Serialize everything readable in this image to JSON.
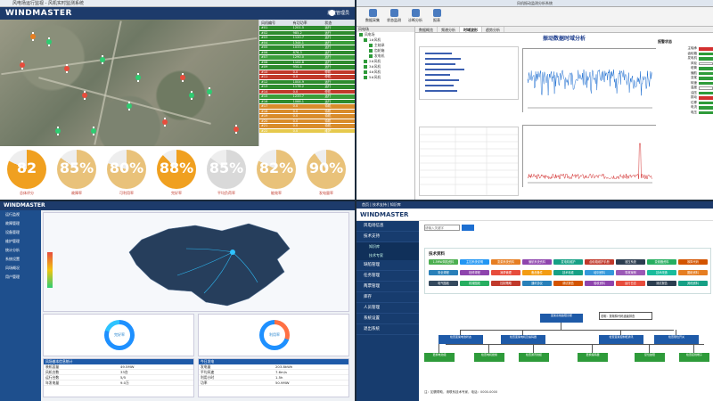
{
  "q1": {
    "brand": "WINDMASTER",
    "window_title": "风电场运行监视 - 风机实时监测系统",
    "user": "系统管理员",
    "table_headers": [
      "风机编号",
      "有功功率",
      "状态"
    ],
    "table_rows": [
      {
        "c": [
          "#01",
          "1201.5",
          "运行"
        ],
        "color": "#2e8b2e"
      },
      {
        "c": [
          "#02",
          "985.2",
          "运行"
        ],
        "color": "#2e8b2e"
      },
      {
        "c": [
          "#03",
          "1120.7",
          "运行"
        ],
        "color": "#2e8b2e"
      },
      {
        "c": [
          "#04",
          "1344.1",
          "运行"
        ],
        "color": "#3a9d3a"
      },
      {
        "c": [
          "#05",
          "1033.6",
          "运行"
        ],
        "color": "#2e8b2e"
      },
      {
        "c": [
          "#06",
          "876.3",
          "运行"
        ],
        "color": "#2e8b2e"
      },
      {
        "c": [
          "#07",
          "1290.0",
          "运行"
        ],
        "color": "#3a9d3a"
      },
      {
        "c": [
          "#08",
          "1102.8",
          "运行"
        ],
        "color": "#2e8b2e"
      },
      {
        "c": [
          "#09",
          "950.4",
          "运行"
        ],
        "color": "#2e8b2e"
      },
      {
        "c": [
          "#10",
          "0.0",
          "停机"
        ],
        "color": "#c0392b"
      },
      {
        "c": [
          "#11",
          "0.0",
          "停机"
        ],
        "color": "#c0392b"
      },
      {
        "c": [
          "#12",
          "1004.9",
          "运行"
        ],
        "color": "#2e8b2e"
      },
      {
        "c": [
          "#13",
          "1178.2",
          "运行"
        ],
        "color": "#2e8b2e"
      },
      {
        "c": [
          "#14",
          "0.0",
          "停机"
        ],
        "color": "#c0392b"
      },
      {
        "c": [
          "#15",
          "1233.7",
          "运行"
        ],
        "color": "#3a9d3a"
      },
      {
        "c": [
          "#16",
          "1066.1",
          "运行"
        ],
        "color": "#2e8b2e"
      },
      {
        "c": [
          "#17",
          "0.0",
          "待机"
        ],
        "color": "#d98c2b"
      },
      {
        "c": [
          "#18",
          "0.0",
          "待机"
        ],
        "color": "#d98c2b"
      },
      {
        "c": [
          "#19",
          "0.0",
          "待机"
        ],
        "color": "#d98c2b"
      },
      {
        "c": [
          "#20",
          "0.0",
          "待机"
        ],
        "color": "#d98c2b"
      },
      {
        "c": [
          "#21",
          "0.0",
          "待机"
        ],
        "color": "#d98c2b"
      },
      {
        "c": [
          "#22",
          "0.0",
          "维护"
        ],
        "color": "#e6c94c"
      }
    ],
    "gauges": [
      {
        "value": "82",
        "label": "总体评分",
        "color": "#f0a020",
        "fill": 0.82
      },
      {
        "value": "85%",
        "label": "故障率",
        "color": "#e9c27a",
        "fill": 0.85
      },
      {
        "value": "80%",
        "label": "可利用率",
        "color": "#e9c27a",
        "fill": 0.8
      },
      {
        "value": "88%",
        "label": "完好率",
        "color": "#f0a020",
        "fill": 0.88
      },
      {
        "value": "85%",
        "label": "平均负荷率",
        "color": "#d9d9d9",
        "fill": 0.85
      },
      {
        "value": "82%",
        "label": "能效率",
        "color": "#e9c27a",
        "fill": 0.82
      },
      {
        "value": "90%",
        "label": "发电量率",
        "color": "#e9c27a",
        "fill": 0.9
      }
    ]
  },
  "q2": {
    "window_title": "风机振动监测分析系统",
    "toolbar": [
      "数据采集",
      "状态监测",
      "诊断分析",
      "报表"
    ],
    "tree_title": "风电场",
    "tree_nodes": [
      "风电场",
      "1#风机",
      "主轴承",
      "齿轮箱",
      "发电机",
      "2#风机",
      "3#风机",
      "4#风机",
      "5#风机"
    ],
    "tabs": [
      "数据概览",
      "频谱分析",
      "时域波形",
      "趋势分析"
    ],
    "heading": "振动数据时域分析",
    "right_title": "报警状态",
    "right_items": [
      {
        "k": "主轴承",
        "s": "r"
      },
      {
        "k": "齿轮箱",
        "s": "g"
      },
      {
        "k": "发电机",
        "s": "g"
      },
      {
        "k": "风轮",
        "s": "w"
      },
      {
        "k": "塔筒",
        "s": "g"
      },
      {
        "k": "偏航",
        "s": "g"
      },
      {
        "k": "变桨",
        "s": "g"
      },
      {
        "k": "转速",
        "s": "g"
      },
      {
        "k": "温度",
        "s": "w"
      },
      {
        "k": "油压",
        "s": "g"
      },
      {
        "k": "振动",
        "s": "r"
      },
      {
        "k": "位移",
        "s": "g"
      },
      {
        "k": "电流",
        "s": "g"
      },
      {
        "k": "电压",
        "s": "g"
      }
    ]
  },
  "q3": {
    "brand": "WINDMASTER",
    "side_items": [
      "运行监视",
      "故障管理",
      "设备管理",
      "维护管理",
      "统计分析",
      "系统设置",
      "风场概况",
      "用户管理"
    ],
    "donut1": {
      "label": "完好率"
    },
    "donut2": {
      "label": "利用率"
    },
    "table1": {
      "header": "风场基本信息统计",
      "rows": [
        [
          "装机容量",
          "49.5MW"
        ],
        [
          "风机台数",
          "33台"
        ],
        [
          "运行台数",
          "5/5"
        ],
        [
          "年发电量",
          "9.0万"
        ]
      ]
    },
    "table2": {
      "header": "今日发电",
      "rows": [
        [
          "发电量",
          "203.8kWh"
        ],
        [
          "平均风速",
          "7.6m/s"
        ],
        [
          "利用小时",
          "1.5h"
        ],
        [
          "功率",
          "50.9MW"
        ]
      ]
    }
  },
  "q4": {
    "brand": "WINDMASTER",
    "topbar": "首页 | 技术支持 | 知识库",
    "side": [
      "风电场信息",
      "技术支持",
      "知识库",
      "技术专家",
      "缺陷管理",
      "任务管理",
      "两票管理",
      "库存",
      "人员管理",
      "系统设置",
      "退出系统"
    ],
    "search_placeholder": "请输入关键字",
    "cat_title": "技术资料",
    "chips": [
      {
        "t": "1.5MW风机资料",
        "c": "#4caf50"
      },
      {
        "t": "主控系统说明",
        "c": "#2196f3"
      },
      {
        "t": "变桨系统资料",
        "c": "#e67e22"
      },
      {
        "t": "偏航系统资料",
        "c": "#8e44ad"
      },
      {
        "t": "发电机维护",
        "c": "#16a085"
      },
      {
        "t": "齿轮箱维护手册",
        "c": "#c0392b"
      },
      {
        "t": "液压系统",
        "c": "#2c3e50"
      },
      {
        "t": "变频器资料",
        "c": "#27ae60"
      },
      {
        "t": "故障代码",
        "c": "#d35400"
      },
      {
        "t": "安全规程",
        "c": "#2980b9"
      },
      {
        "t": "检修规程",
        "c": "#8e44ad"
      },
      {
        "t": "润滑管理",
        "c": "#e74c3c"
      },
      {
        "t": "备品备件",
        "c": "#f39c12"
      },
      {
        "t": "技术标准",
        "c": "#16a085"
      },
      {
        "t": "培训资料",
        "c": "#3498db"
      },
      {
        "t": "事故案例",
        "c": "#9b59b6"
      },
      {
        "t": "技术改造",
        "c": "#1abc9c"
      },
      {
        "t": "图纸资料",
        "c": "#e67e22"
      },
      {
        "t": "电气图纸",
        "c": "#34495e"
      },
      {
        "t": "机械图纸",
        "c": "#27ae60"
      },
      {
        "t": "控制策略",
        "c": "#c0392b"
      },
      {
        "t": "通讯协议",
        "c": "#2980b9"
      },
      {
        "t": "调试报告",
        "c": "#d35400"
      },
      {
        "t": "验收资料",
        "c": "#8e44ad"
      },
      {
        "t": "运行日志",
        "c": "#e74c3c"
      },
      {
        "t": "测试报告",
        "c": "#2c3e50"
      },
      {
        "t": "其他资料",
        "c": "#16a085"
      }
    ],
    "flow": {
      "root": "变桨系统故障诊断",
      "note": "说明：按故障代码逐级排查",
      "level2": [
        "检查变桨电池状态",
        "检查变桨电机及编码器",
        "检查变桨控制柜通讯",
        "检查限位开关"
      ],
      "level3": [
        "更换电池组",
        "检查电机绝缘",
        "检查通讯线缆",
        "更换编码器",
        "复位故障",
        "检查接线端子"
      ]
    },
    "footer": "注：如需帮助，请联系技术专家，电话：0000-0000"
  }
}
